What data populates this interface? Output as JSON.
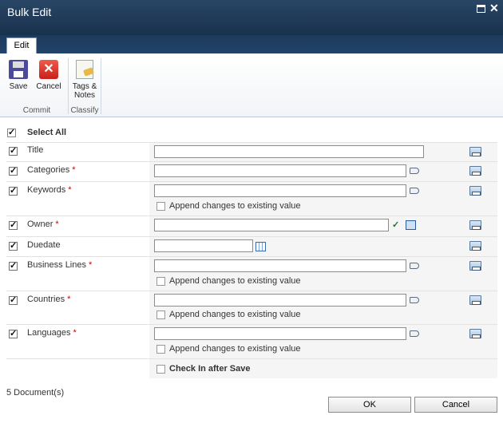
{
  "window": {
    "title": "Bulk Edit"
  },
  "ribbon": {
    "tab": "Edit",
    "save": "Save",
    "cancel": "Cancel",
    "tags_notes_line1": "Tags &",
    "tags_notes_line2": "Notes",
    "group_commit": "Commit",
    "group_classify": "Classify"
  },
  "form": {
    "select_all": "Select All",
    "append_label": "Append changes to existing value",
    "checkin_label": "Check In after Save",
    "required_marker": "*",
    "fields": [
      {
        "label": "Title",
        "required": false
      },
      {
        "label": "Categories",
        "required": true
      },
      {
        "label": "Keywords",
        "required": true
      },
      {
        "label": "Owner",
        "required": true
      },
      {
        "label": "Duedate",
        "required": false
      },
      {
        "label": "Business Lines",
        "required": true
      },
      {
        "label": "Countries",
        "required": true
      },
      {
        "label": "Languages",
        "required": true
      }
    ]
  },
  "footer": {
    "count": "5  Document(s)",
    "ok": "OK",
    "cancel": "Cancel"
  }
}
